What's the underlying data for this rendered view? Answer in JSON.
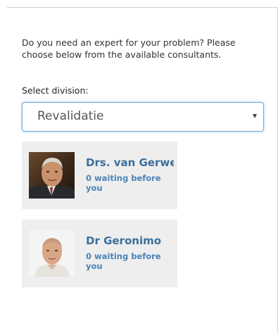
{
  "intro_text": "Do you need an expert for your problem? Please choose below from the available consultants.",
  "division": {
    "label": "Select division:",
    "selected": "Revalidatie"
  },
  "consultants": [
    {
      "name": "Drs. van Gerwe",
      "status": "0 waiting before you"
    },
    {
      "name": "Dr Geronimo",
      "status": "0 waiting before you"
    }
  ],
  "colors": {
    "accent_text": "#3b6f9e",
    "status_text": "#4a84b8",
    "card_background": "#eeeeee",
    "select_border": "#6fa8dc"
  },
  "icons": {
    "select_arrow": "chevron-down-icon"
  }
}
